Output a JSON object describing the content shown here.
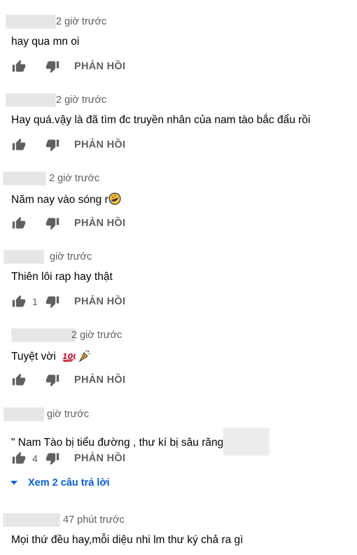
{
  "reply_label": "PHẢN HỒI",
  "comments": [
    {
      "time": "2 giờ trước",
      "text": "hay qua mn oi",
      "likes": ""
    },
    {
      "time": "2 giờ trước",
      "text": "Hay quá.vậy là đã tìm đc truyền nhân của nam tào bắc đẩu rồi",
      "likes": ""
    },
    {
      "time": "2 giờ trước",
      "text": "Năm nay vào sóng r",
      "likes": ""
    },
    {
      "time": "giờ trước",
      "text": "Thiên lôi rap hay thật",
      "likes": "1"
    },
    {
      "time": "2 giờ trước",
      "text": "Tuyệt vời",
      "likes": ""
    },
    {
      "time": "giờ trước",
      "text": "\" Nam Tào bị tiểu đường , thư kí bị sâu răng",
      "likes": "4"
    },
    {
      "time": "47 phút trước",
      "text": "Mọi thứ đều hay,mỗi diệu nhi lm thư ký chả ra gì",
      "likes": ""
    }
  ],
  "view_replies": "Xem 2 câu trả lời",
  "icons": {
    "like": "thumb-up-icon",
    "dislike": "thumb-down-icon",
    "expand": "caret-down-icon",
    "emoji_laugh": "rolling-laughing-emoji",
    "emoji_100": "hundred-points-emoji",
    "emoji_party": "party-popper-emoji"
  },
  "colors": {
    "text": "#030303",
    "secondary": "#606060",
    "link": "#065fd4",
    "icon": "#606060"
  }
}
